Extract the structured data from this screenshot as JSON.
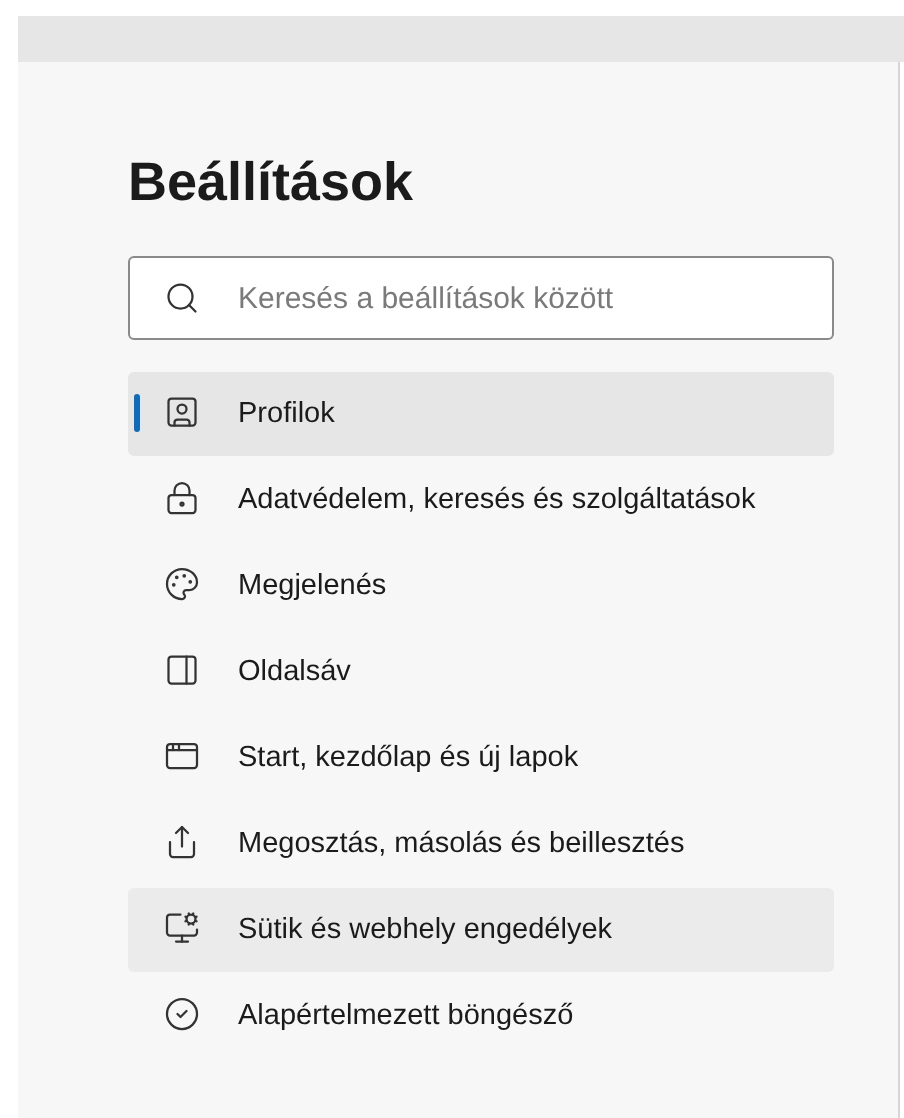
{
  "title": "Beállítások",
  "search": {
    "placeholder": "Keresés a beállítások között"
  },
  "items": [
    {
      "label": "Profilok",
      "selected": true,
      "hovered": false
    },
    {
      "label": "Adatvédelem, keresés és szolgáltatások",
      "selected": false,
      "hovered": false
    },
    {
      "label": "Megjelenés",
      "selected": false,
      "hovered": false
    },
    {
      "label": "Oldalsáv",
      "selected": false,
      "hovered": false
    },
    {
      "label": "Start, kezdőlap és új lapok",
      "selected": false,
      "hovered": false
    },
    {
      "label": "Megosztás, másolás és beillesztés",
      "selected": false,
      "hovered": false
    },
    {
      "label": "Sütik és webhely engedélyek",
      "selected": false,
      "hovered": true
    },
    {
      "label": "Alapértelmezett böngésző",
      "selected": false,
      "hovered": false
    }
  ]
}
